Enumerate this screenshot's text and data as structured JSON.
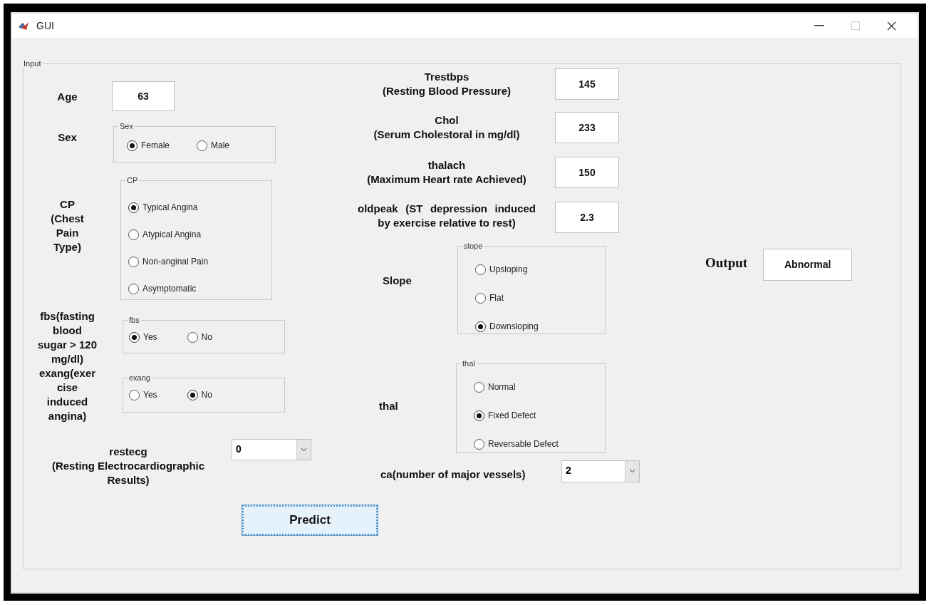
{
  "window": {
    "title": "GUI"
  },
  "panel": {
    "title": "Input"
  },
  "age": {
    "label": "Age",
    "value": "63"
  },
  "sex": {
    "label": "Sex",
    "group": {
      "title": "Sex",
      "kind": "row",
      "options": [
        {
          "label": "Female",
          "selected": true
        },
        {
          "label": "Male",
          "selected": false
        }
      ]
    }
  },
  "cp": {
    "label": "CP (Chest Pain Type)",
    "group": {
      "title": "CP",
      "kind": "column",
      "options": [
        {
          "label": "Typical Angina",
          "selected": true
        },
        {
          "label": "Atypical Angina",
          "selected": false
        },
        {
          "label": "Non-anginal Pain",
          "selected": false
        },
        {
          "label": "Asymptomatic",
          "selected": false
        }
      ]
    }
  },
  "fbs": {
    "label": "fbs(fasting blood sugar > 120 mg/dl)",
    "group": {
      "title": "fbs",
      "kind": "row",
      "options": [
        {
          "label": "Yes",
          "selected": true
        },
        {
          "label": "No",
          "selected": false
        }
      ]
    }
  },
  "exang": {
    "label": "exang(exercise induced angina)",
    "group": {
      "title": "exang",
      "kind": "row",
      "options": [
        {
          "label": "Yes",
          "selected": false
        },
        {
          "label": "No",
          "selected": true
        }
      ]
    }
  },
  "restecg": {
    "label": "restecg",
    "sublabel": "(Resting Electrocardiographic Results)",
    "value": "0"
  },
  "predict_button": {
    "label": "Predict"
  },
  "numeric_fields": [
    {
      "label": "Trestbps",
      "sublabel": "(Resting Blood Pressure)",
      "value": "145"
    },
    {
      "label": "Chol",
      "sublabel": "(Serum Cholestoral in mg/dl)",
      "value": "233"
    },
    {
      "label": "thalach",
      "sublabel": "(Maximum Heart rate Achieved)",
      "value": "150"
    },
    {
      "label": "oldpeak (ST depression induced by exercise relative to rest)",
      "value": "2.3"
    }
  ],
  "slope": {
    "label": "Slope",
    "group": {
      "title": "slope",
      "kind": "column",
      "options": [
        {
          "label": "Upsloping",
          "selected": false
        },
        {
          "label": "Flat",
          "selected": false
        },
        {
          "label": "Downsloping",
          "selected": true
        }
      ]
    }
  },
  "thal": {
    "label": "thal",
    "group": {
      "title": "thal",
      "kind": "column",
      "options": [
        {
          "label": "Normal",
          "selected": false
        },
        {
          "label": "Fixed Defect",
          "selected": true
        },
        {
          "label": "Reversable Defect",
          "selected": false
        }
      ]
    }
  },
  "ca": {
    "label": "ca(number of major vessels)",
    "value": "2"
  },
  "output": {
    "label": "Output",
    "value": "Abnormal"
  }
}
